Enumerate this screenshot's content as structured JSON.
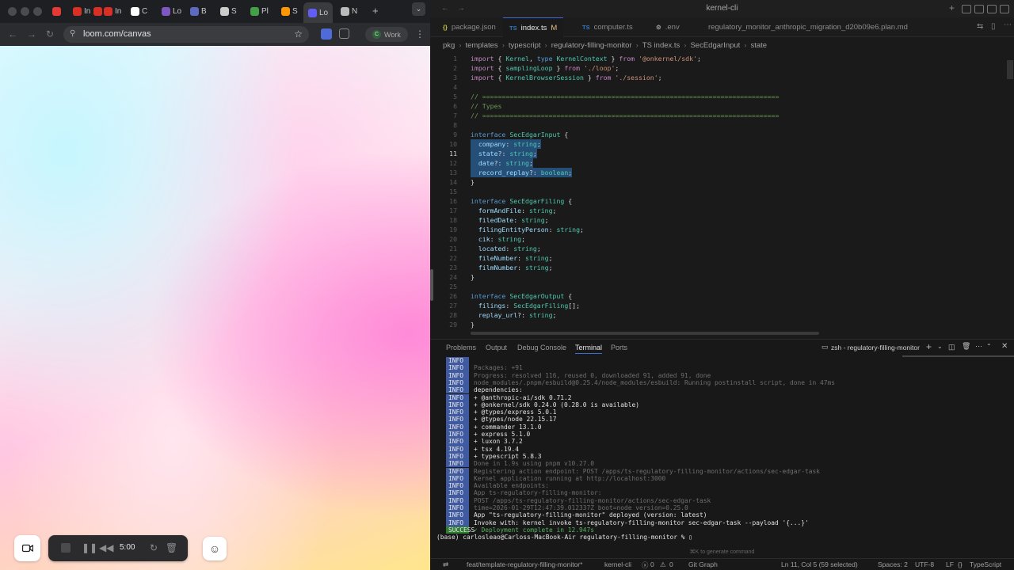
{
  "browser": {
    "tabs": [
      {
        "icon": "record-icon",
        "label": "",
        "color": "#e53935"
      },
      {
        "icon": "gmail-icon",
        "label": "In",
        "color": "#d93025"
      },
      {
        "icon": "gmail-icon",
        "label": "In",
        "color": "#d93025"
      },
      {
        "icon": "gmail-icon",
        "label": "In",
        "color": "#d93025"
      },
      {
        "icon": "github-icon",
        "label": "C",
        "color": "#ffffff"
      },
      {
        "icon": "linear-icon",
        "label": "Lo",
        "color": "#7e57c2"
      },
      {
        "icon": "app-icon",
        "label": "B",
        "color": "#5c6bc0"
      },
      {
        "icon": "openai-icon",
        "label": "S",
        "color": "#cccccc"
      },
      {
        "icon": "app-icon",
        "label": "Pl",
        "color": "#43a047"
      },
      {
        "icon": "app-icon",
        "label": "S",
        "color": "#ff9800"
      },
      {
        "icon": "loom-icon",
        "label": "Lo",
        "color": "#625df5",
        "active": true
      },
      {
        "icon": "globe-icon",
        "label": "N",
        "color": "#bbbbbb"
      }
    ],
    "url": "loom.com/canvas",
    "profile_label": "Work",
    "profile_initial": "C"
  },
  "recorder": {
    "time": "5:00"
  },
  "editor": {
    "window_title": "kernel-cli",
    "tabs": [
      {
        "lang": "{}",
        "label": "package.json",
        "lang_color": "#cbcb41"
      },
      {
        "lang": "TS",
        "label": "index.ts",
        "badge": "M",
        "active": true,
        "lang_color": "#3178c6"
      },
      {
        "lang": "TS",
        "label": "computer.ts",
        "lang_color": "#3178c6"
      },
      {
        "lang": "⚙",
        "label": ".env",
        "lang_color": "#999999"
      },
      {
        "lang": "",
        "label": "regulatory_monitor_anthropic_migration_d20b09e6.plan.md",
        "lang_color": "#999999"
      }
    ],
    "breadcrumb": [
      "pkg",
      "templates",
      "typescript",
      "regulatory-filling-monitor",
      "TS index.ts",
      "SecEdgarInput",
      "state"
    ],
    "cursor_line": 11,
    "lines": [
      {
        "n": "1",
        "t": "import { Kernel, type KernelContext } from '@onkernel/sdk';"
      },
      {
        "n": "2",
        "t": "import { samplingLoop } from './loop';"
      },
      {
        "n": "3",
        "t": "import { KernelBrowserSession } from './session';"
      },
      {
        "n": "4",
        "t": ""
      },
      {
        "n": "5",
        "t": "// ============================================================================"
      },
      {
        "n": "6",
        "t": "// Types"
      },
      {
        "n": "7",
        "t": "// ============================================================================"
      },
      {
        "n": "8",
        "t": ""
      },
      {
        "n": "9",
        "t": "interface SecEdgarInput {"
      },
      {
        "n": "10",
        "t": "  company: string;"
      },
      {
        "n": "11",
        "t": "  state?: string;"
      },
      {
        "n": "12",
        "t": "  date?: string;"
      },
      {
        "n": "13",
        "t": "  record_replay?: boolean;"
      },
      {
        "n": "14",
        "t": "}"
      },
      {
        "n": "15",
        "t": ""
      },
      {
        "n": "16",
        "t": "interface SecEdgarFiling {"
      },
      {
        "n": "17",
        "t": "  formAndFile: string;"
      },
      {
        "n": "18",
        "t": "  filedDate: string;"
      },
      {
        "n": "19",
        "t": "  filingEntityPerson: string;"
      },
      {
        "n": "20",
        "t": "  cik: string;"
      },
      {
        "n": "21",
        "t": "  located: string;"
      },
      {
        "n": "22",
        "t": "  fileNumber: string;"
      },
      {
        "n": "23",
        "t": "  filmNumber: string;"
      },
      {
        "n": "24",
        "t": "}"
      },
      {
        "n": "25",
        "t": ""
      },
      {
        "n": "26",
        "t": "interface SecEdgarOutput {"
      },
      {
        "n": "27",
        "t": "  filings: SecEdgarFiling[];"
      },
      {
        "n": "28",
        "t": "  replay_url?: string;"
      },
      {
        "n": "29",
        "t": "}"
      }
    ]
  },
  "panel": {
    "tabs": [
      "Problems",
      "Output",
      "Debug Console",
      "Terminal",
      "Ports"
    ],
    "active_tab": "Terminal",
    "shell_name": "zsh - regulatory-filling-monitor",
    "terminal_lines": [
      {
        "tag": "INFO",
        "text": ""
      },
      {
        "tag": "INFO",
        "text": "Packages: +91",
        "tone": "d"
      },
      {
        "tag": "INFO",
        "text": "Progress: resolved 116, reused 0, downloaded 91, added 91, done",
        "tone": "d"
      },
      {
        "tag": "INFO",
        "text": "node_modules/.pnpm/esbuild@0.25.4/node_modules/esbuild: Running postinstall script, done in 47ms",
        "tone": "d"
      },
      {
        "tag": "INFO",
        "text": "dependencies:",
        "tone": "w"
      },
      {
        "tag": "INFO",
        "text": "+ @anthropic-ai/sdk 0.71.2",
        "tone": "w"
      },
      {
        "tag": "INFO",
        "text": "+ @onkernel/sdk 0.24.0 (0.28.0 is available)",
        "tone": "w"
      },
      {
        "tag": "INFO",
        "text": "+ @types/express 5.0.1",
        "tone": "w"
      },
      {
        "tag": "INFO",
        "text": "+ @types/node 22.15.17",
        "tone": "w"
      },
      {
        "tag": "INFO",
        "text": "+ commander 13.1.0",
        "tone": "w"
      },
      {
        "tag": "INFO",
        "text": "+ express 5.1.0",
        "tone": "w"
      },
      {
        "tag": "INFO",
        "text": "+ luxon 3.7.2",
        "tone": "w"
      },
      {
        "tag": "INFO",
        "text": "+ tsx 4.19.4",
        "tone": "w"
      },
      {
        "tag": "INFO",
        "text": "+ typescript 5.8.3",
        "tone": "w"
      },
      {
        "tag": "INFO",
        "text": "Done in 1.9s using pnpm v10.27.0",
        "tone": "d"
      },
      {
        "tag": "INFO",
        "text": "Registering action endpoint: POST /apps/ts-regulatory-filling-monitor/actions/sec-edgar-task",
        "tone": "d"
      },
      {
        "tag": "INFO",
        "text": "Kernel application running at http://localhost:3000",
        "tone": "d"
      },
      {
        "tag": "INFO",
        "text": "Available endpoints:",
        "tone": "d"
      },
      {
        "tag": "INFO",
        "text": "App ts-regulatory-filling-monitor:",
        "tone": "d"
      },
      {
        "tag": "INFO",
        "text": "POST /apps/ts-regulatory-filling-monitor/actions/sec-edgar-task",
        "tone": "d"
      },
      {
        "tag": "INFO",
        "text": "time=2026-01-29T12:47:39.012337Z boot=node version=0.25.0",
        "tone": "d"
      },
      {
        "tag": "INFO",
        "text": "App \"ts-regulatory-filling-monitor\" deployed (version: latest)",
        "tone": "w"
      },
      {
        "tag": "INFO",
        "text": "Invoke with: kernel invoke ts-regulatory-filling-monitor sec-edgar-task --payload '{...}'",
        "tone": "w"
      },
      {
        "tag": "SUCCESS",
        "text": "✓ Deployment complete in 12.947s",
        "tone": "g"
      }
    ],
    "prompt": "(base) carlosleao@Carloss-MacBook-Air regulatory-filling-monitor % ▯",
    "hint": "⌘K to generate command"
  },
  "status": {
    "branch": "feat/template-regulatory-filling-monitor*",
    "project": "kernel-cli",
    "errors": "0",
    "warnings": "0",
    "git_graph": "Git Graph",
    "cursor_pos": "Ln 11, Col 5 (59 selected)",
    "spaces": "Spaces: 2",
    "encoding": "UTF-8",
    "eol": "LF",
    "language": "TypeScript"
  }
}
